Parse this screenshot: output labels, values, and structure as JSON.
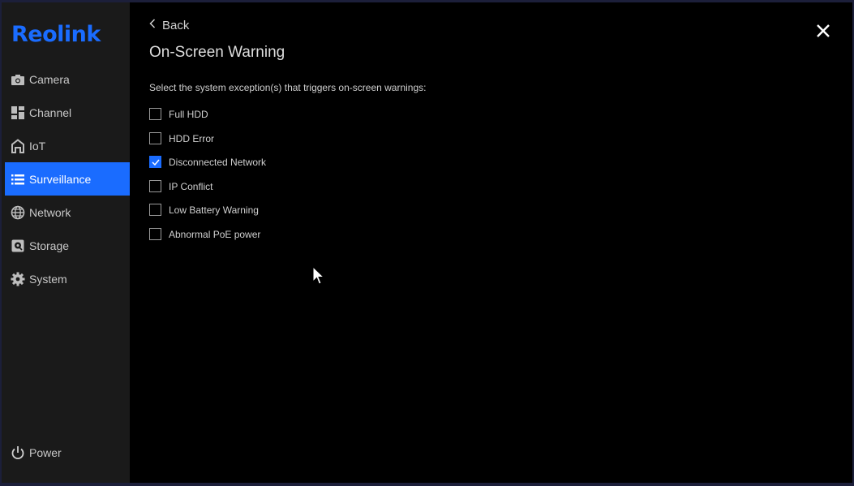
{
  "brand": {
    "logo_text": "Reolink",
    "accent": "#1a6cff"
  },
  "sidebar": {
    "items": [
      {
        "label": "Camera",
        "icon": "camera-icon",
        "active": false
      },
      {
        "label": "Channel",
        "icon": "channel-grid-icon",
        "active": false
      },
      {
        "label": "IoT",
        "icon": "home-icon",
        "active": false
      },
      {
        "label": "Surveillance",
        "icon": "list-icon",
        "active": true
      },
      {
        "label": "Network",
        "icon": "globe-icon",
        "active": false
      },
      {
        "label": "Storage",
        "icon": "storage-icon",
        "active": false
      },
      {
        "label": "System",
        "icon": "gear-icon",
        "active": false
      }
    ],
    "power_label": "Power"
  },
  "main": {
    "back_label": "Back",
    "title": "On-Screen Warning",
    "instruction": "Select the system exception(s) that triggers on-screen warnings:",
    "options": [
      {
        "label": "Full HDD",
        "checked": false
      },
      {
        "label": "HDD Error",
        "checked": false
      },
      {
        "label": "Disconnected Network",
        "checked": true
      },
      {
        "label": "IP Conflict",
        "checked": false
      },
      {
        "label": "Low Battery Warning",
        "checked": false
      },
      {
        "label": "Abnormal PoE power",
        "checked": false
      }
    ]
  }
}
